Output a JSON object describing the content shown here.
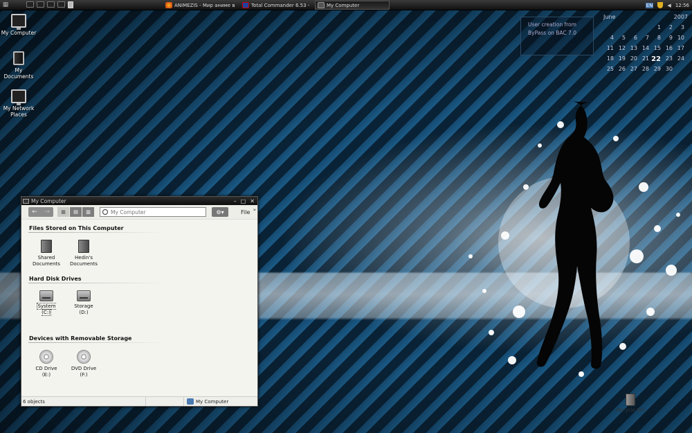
{
  "taskbar": {
    "tasks": [
      {
        "label": "ANIMEZIS - Мир аниме в..."
      },
      {
        "label": "Total Commander 6.53 - ..."
      },
      {
        "label": "My Computer"
      }
    ],
    "language": "EN",
    "clock": "12:56"
  },
  "desktop": {
    "icons": [
      {
        "label": "My Computer"
      },
      {
        "label": "My Documents"
      },
      {
        "label": "My Network Places"
      }
    ],
    "recycle_bin": "Recycle Bin",
    "info_text": "User creation from ByPass on BAC 7.0"
  },
  "calendar": {
    "month": "June",
    "year": "2007",
    "today": "22",
    "days": [
      "",
      "",
      "",
      "",
      "1",
      "2",
      "3",
      "4",
      "5",
      "6",
      "7",
      "8",
      "9",
      "10",
      "11",
      "12",
      "13",
      "14",
      "15",
      "16",
      "17",
      "18",
      "19",
      "20",
      "21",
      "22",
      "23",
      "24",
      "25",
      "26",
      "27",
      "28",
      "29",
      "30",
      ""
    ]
  },
  "window": {
    "title": "My Computer",
    "search_placeholder": "My Computer",
    "file_menu": "File",
    "groups": [
      {
        "title": "Files Stored on This Computer",
        "items": [
          "Shared Documents",
          "Hedin's Documents"
        ]
      },
      {
        "title": "Hard Disk Drives",
        "items": [
          "System (C:)",
          "Storage (D:)"
        ]
      },
      {
        "title": "Devices with Removable Storage",
        "items": [
          "CD Drive (E:)",
          "DVD Drive (F:)"
        ]
      }
    ],
    "status_left": "6 objects",
    "status_right": "My Computer"
  },
  "colors": {
    "taskbar": "#111111",
    "stripe_dark": "#0a2235",
    "stripe_light": "#1a5a86",
    "window_bg": "#f4f4ef"
  }
}
